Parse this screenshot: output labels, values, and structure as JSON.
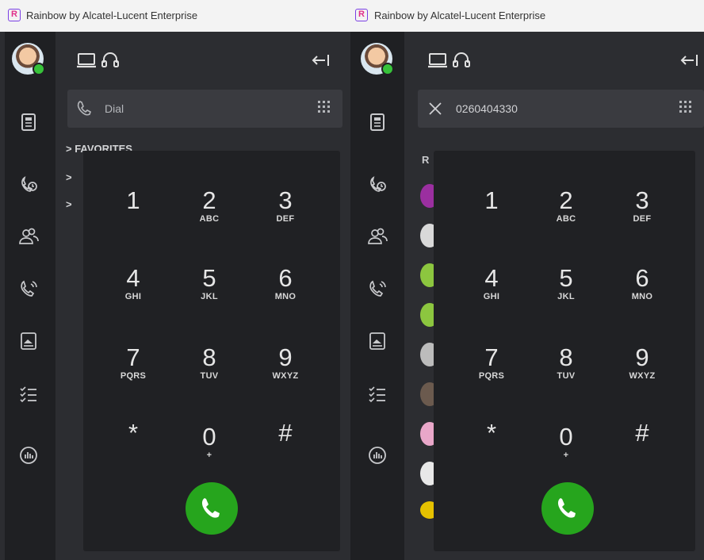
{
  "app": {
    "window_title": "Rainbow by Alcatel-Lucent Enterprise",
    "logo_letter": "R"
  },
  "rail_items": [
    "news-icon",
    "calls-history-icon",
    "contacts-icon",
    "voicemail-icon",
    "files-icon",
    "tasks-icon",
    "analytics-icon"
  ],
  "left": {
    "dial_placeholder": "Dial",
    "sections": [
      "> FAVORITES",
      ">",
      ">"
    ]
  },
  "right": {
    "dial_value": "0260404330",
    "recent_header": "R"
  },
  "keypad": {
    "keys": [
      {
        "digit": "1",
        "letters": ""
      },
      {
        "digit": "2",
        "letters": "ABC"
      },
      {
        "digit": "3",
        "letters": "DEF"
      },
      {
        "digit": "4",
        "letters": "GHI"
      },
      {
        "digit": "5",
        "letters": "JKL"
      },
      {
        "digit": "6",
        "letters": "MNO"
      },
      {
        "digit": "7",
        "letters": "PQRS"
      },
      {
        "digit": "8",
        "letters": "TUV"
      },
      {
        "digit": "9",
        "letters": "WXYZ"
      },
      {
        "digit": "*",
        "letters": ""
      },
      {
        "digit": "0",
        "letters": "+"
      },
      {
        "digit": "#",
        "letters": ""
      }
    ]
  },
  "colors": {
    "call_button": "#26a51d",
    "status_online": "#37c33a",
    "rail_bg": "#1f2023",
    "panel_bg": "#2c2d31",
    "keypad_bg": "#202124"
  }
}
